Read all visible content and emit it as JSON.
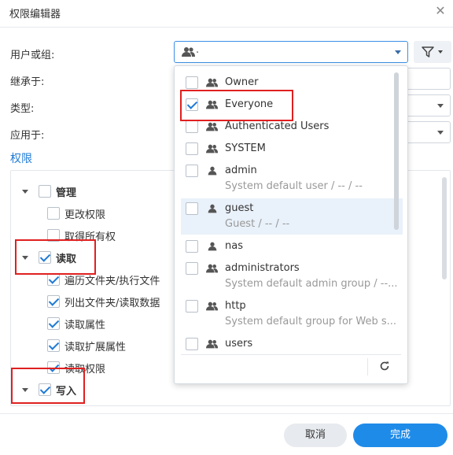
{
  "dialog": {
    "title": "权限编辑器"
  },
  "form": {
    "user_group_label": "用户或组:",
    "inherit_label": "继承于:",
    "type_label": "类型:",
    "apply_label": "应用于:",
    "permissions_section": "权限"
  },
  "tree": {
    "items": [
      {
        "label": "管理",
        "checked": false
      },
      {
        "label": "更改权限",
        "checked": false
      },
      {
        "label": "取得所有权",
        "checked": false
      },
      {
        "label": "读取",
        "checked": true
      },
      {
        "label": "遍历文件夹/执行文件",
        "checked": true
      },
      {
        "label": "列出文件夹/读取数据",
        "checked": true
      },
      {
        "label": "读取属性",
        "checked": true
      },
      {
        "label": "读取扩展属性",
        "checked": true
      },
      {
        "label": "读取权限",
        "checked": true
      },
      {
        "label": "写入",
        "checked": true
      }
    ]
  },
  "dropdown": {
    "items": [
      {
        "name": "Owner",
        "desc": "",
        "type": "group-icon",
        "checked": false
      },
      {
        "name": "Everyone",
        "desc": "",
        "type": "group-icon",
        "checked": true
      },
      {
        "name": "Authenticated Users",
        "desc": "",
        "type": "group-icon",
        "checked": false
      },
      {
        "name": "SYSTEM",
        "desc": "",
        "type": "group-icon",
        "checked": false
      },
      {
        "name": "admin",
        "desc": "System default user / -- / --",
        "type": "user-icon",
        "checked": false
      },
      {
        "name": "guest",
        "desc": "Guest / -- / --",
        "type": "user-icon",
        "checked": false
      },
      {
        "name": "nas",
        "desc": "",
        "type": "user-icon",
        "checked": false
      },
      {
        "name": "administrators",
        "desc": "System default admin group / --...",
        "type": "group-icon",
        "checked": false
      },
      {
        "name": "http",
        "desc": "System default group for Web s...",
        "type": "group-icon",
        "checked": false
      },
      {
        "name": "users",
        "desc": "",
        "type": "group-icon",
        "checked": false
      }
    ]
  },
  "footer": {
    "cancel": "取消",
    "ok": "完成"
  },
  "colors": {
    "accent": "#1f8be8",
    "highlight": "#e02020",
    "link": "#1f7ad6"
  }
}
